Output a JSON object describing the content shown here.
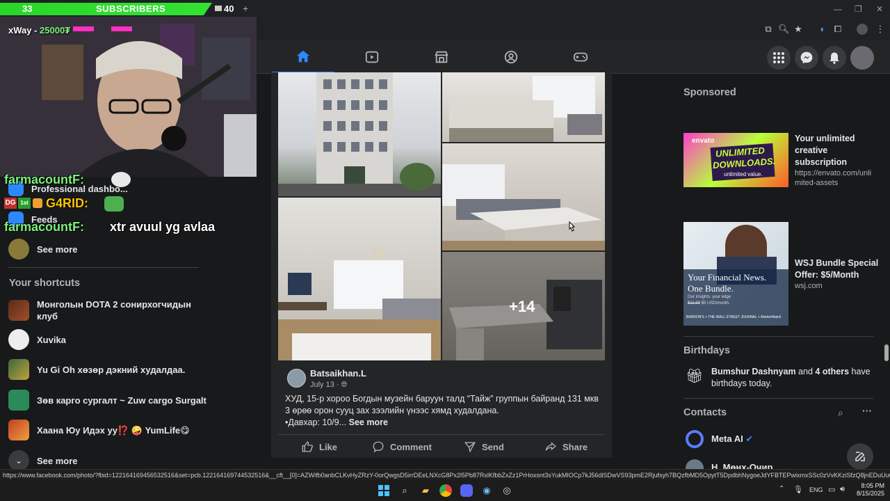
{
  "stream": {
    "sub_count": "33",
    "sub_label": "SUBSCRIBERS",
    "sub_goal": "40",
    "sub_plus": "+",
    "donor": "xWay - ",
    "donor_amount": "25000₮",
    "chat": [
      {
        "user": "farmacountF:",
        "message": ""
      },
      {
        "user": "G4RID:",
        "message": ""
      },
      {
        "user": "farmacountF:",
        "message": "xtr avuul yg avlaa"
      }
    ],
    "badges": [
      "DG",
      "1st"
    ]
  },
  "sidebar": {
    "partial_items": [
      "Professional dashbo...",
      "Feeds"
    ],
    "see_more": "See more",
    "shortcuts_title": "Your shortcuts",
    "shortcuts": [
      {
        "label": "Монголын DOTA 2 сонирхогчидын клуб"
      },
      {
        "label": "Xuvika"
      },
      {
        "label": "Yu Gi Oh хөзөр дэкний худалдаа."
      },
      {
        "label": "Зөв карго сургалт ~ Zuw cargo Surgalt"
      },
      {
        "label": "Хаана Юу Идэх уу⁉️ 🤪 YumLife😋"
      }
    ],
    "see_more_bottom": "See more"
  },
  "post": {
    "more_photos": "+14",
    "author": "Batsaikhan.L",
    "date": "July 13",
    "date_sep": "·",
    "text": "ХУД, 15-р хороо Богдын музейн баруун талд “Тайж” группын байранд 131 мкв 3 өрөө орон сууц зах зээлийн үнээс хямд худалдана.",
    "text_line2": "•Давхар: 10/9...",
    "see_more": "See more",
    "actions": {
      "like": "Like",
      "comment": "Comment",
      "send": "Send",
      "share": "Share"
    }
  },
  "right": {
    "sponsored": "Sponsored",
    "ads": [
      {
        "title": "Your unlimited creative subscription",
        "url": "https://envato.com/unlimited-assets",
        "url_line1": "https://envato.com/unli",
        "url_line2": "mited-assets",
        "brand": "envato",
        "headline1": "UNLIMITED",
        "headline2": "DOWNLOADS.",
        "tagline": "unlimited value."
      },
      {
        "title": "WSJ Bundle Special Offer: $5/Month",
        "url": "wsj.com",
        "headline1": "Your Financial News.",
        "headline2": "One Bundle.",
        "small": "Our insights, your edge",
        "price_old": "$11.99",
        "price_new": "$5 USD/month.",
        "brands": "BARRON'S + THE WALL STREET JOURNAL + MarketWatch"
      }
    ],
    "birthdays_title": "Birthdays",
    "birthday_name": "Bumshur Dashnyam",
    "birthday_and": "and",
    "birthday_others": "4 others",
    "birthday_have": "have",
    "birthday_line2": "birthdays today.",
    "contacts_title": "Contacts",
    "contacts": [
      {
        "name": "Meta AI"
      },
      {
        "name": "Н. Мөнх-Очир"
      }
    ]
  },
  "status_url": "https://www.facebook.com/photo/?fbid=122164169456532516&set=pcb.122164169744532516&__cft__[0]=AZWifb0anbCLKvHyZRzY-0orQwgsD5irrDEeLNXcG8Px2l5Pb87RxlKfbbZxZz1PrHoxsnt3sYukMIOCp7kJ56dlSDwVS93pmE2Rjufsyh7BQzfbMD5OpytT5DpdbhNygoeJdYFBTEPwixmxSSc0zVvKKziSfzQ8jnEDuUuOTtRiajPpNEyaOiHrAmutKR_M-5H2Pz4Tk...",
  "taskbar": {
    "lang": "ENG",
    "time": "8:05 PM",
    "date": "8/15/2025"
  },
  "colors": {
    "fb_blue": "#2d88ff",
    "bg": "#18191a",
    "card": "#242526",
    "sub_green": "#2bd62b"
  }
}
